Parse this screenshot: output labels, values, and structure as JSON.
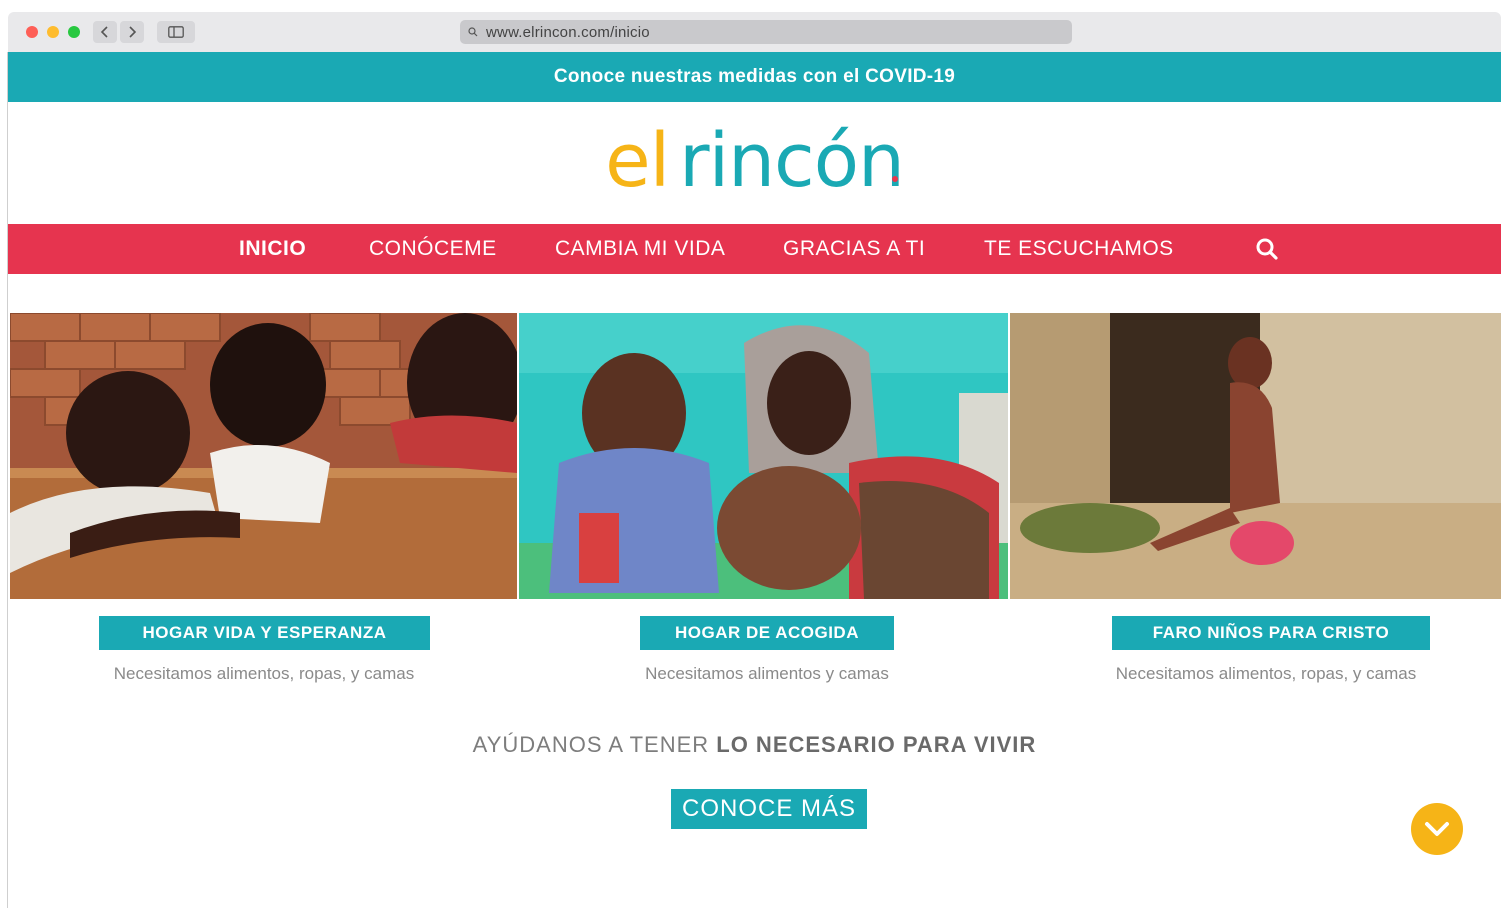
{
  "browser": {
    "url": "www.elrincon.com/inicio",
    "icons": {
      "back": "chevron-left-icon",
      "forward": "chevron-right-icon",
      "sidebar": "sidebar-icon",
      "search": "search-icon"
    }
  },
  "announcement": {
    "text": "Conoce nuestras medidas con el COVID-19",
    "color": "#1aa9b4"
  },
  "logo": {
    "part1": "el",
    "part2": "rincón",
    "part1_color": "#f6b417",
    "part2_color": "#1aa9b4"
  },
  "nav": {
    "color": "#e6344f",
    "items": [
      {
        "label": "INICIO",
        "active": true
      },
      {
        "label": "CONÓCEME",
        "active": false
      },
      {
        "label": "CAMBIA MI VIDA",
        "active": false
      },
      {
        "label": "GRACIAS A TI",
        "active": false
      },
      {
        "label": "TE ESCUCHAMOS",
        "active": false
      }
    ],
    "search_icon": "search-icon"
  },
  "cards": [
    {
      "title": "HOGAR VIDA Y ESPERANZA",
      "text": "Necesitamos alimentos, ropas, y camas"
    },
    {
      "title": "HOGAR DE ACOGIDA",
      "text": "Necesitamos alimentos y camas"
    },
    {
      "title": "FARO NIÑOS PARA CRISTO",
      "text": "Necesitamos alimentos, ropas, y camas"
    }
  ],
  "tagline": {
    "normal": "AYÚDANOS A TENER ",
    "bold": "LO NECESARIO PARA VIVIR"
  },
  "cta": {
    "label": "CONOCE MÁS"
  },
  "scroll_button": {
    "icon": "chevron-down-icon",
    "color": "#f6b417"
  }
}
